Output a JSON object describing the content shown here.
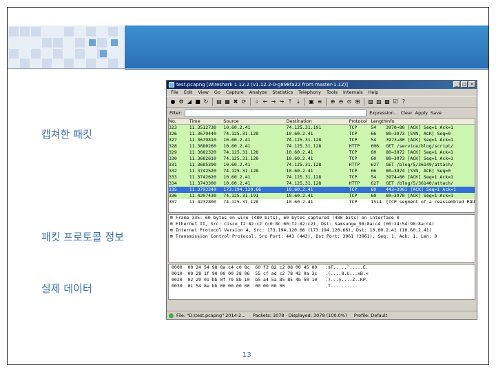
{
  "slide": {
    "label_capture": "캡쳐한 패킷",
    "label_protocol": "패킷 프로토콜 정보",
    "label_data": "실제 데이터",
    "page_number": "13"
  },
  "colors": {
    "banner_blue": "#2a6fb4",
    "label_blue": "#3a6fb0",
    "row_green": "#ccf5b0",
    "row_selected": "#3270d8",
    "row_white": "#ffffff"
  },
  "wireshark": {
    "title": "test.pcapng  [Wireshark 1.12.2  (v1.12.2-0-g898fa22 from master-1.12)]",
    "menus": [
      "File",
      "Edit",
      "View",
      "Go",
      "Capture",
      "Analyze",
      "Statistics",
      "Telephony",
      "Tools",
      "Internals",
      "Help"
    ],
    "toolbar_icons": [
      "record-icon",
      "settings-icon",
      "start-icon",
      "stop-icon",
      "restart-icon",
      "open-icon",
      "save-icon",
      "close-file-icon",
      "reload-icon",
      "find-icon",
      "back-icon",
      "forward-icon",
      "goto-icon",
      "first-icon",
      "last-icon",
      "colorize-icon",
      "autoscroll-icon",
      "zoom-in-icon",
      "zoom-out-icon",
      "zoom-reset-icon",
      "resize-columns-icon",
      "capture-filter-icon",
      "display-filter-icon",
      "coloring-rules-icon",
      "preferences-icon",
      "help-icon"
    ],
    "filter": {
      "label": "Filter:",
      "value": "",
      "expression": "Expression...",
      "clear": "Clear",
      "apply": "Apply",
      "save": "Save"
    },
    "columns": [
      "No.",
      "Time",
      "Source",
      "Destination",
      "Protocol",
      "Length",
      "Info"
    ],
    "packets": [
      {
        "no": "323",
        "time": "11.3512730",
        "src": "10.60.2.41",
        "dst": "74.125.31.191",
        "proto": "TCP",
        "len": "54",
        "info": "3970→80 [ACK] Seq=1 Ack=1",
        "style": "green"
      },
      {
        "no": "326",
        "time": "11.3679440",
        "src": "74.125.31.128",
        "dst": "10.60.2.41",
        "proto": "TCP",
        "len": "66",
        "info": "80→3973 [SYN, ACK] Seq=0",
        "style": "green"
      },
      {
        "no": "327",
        "time": "11.3679810",
        "src": "10.60.2.41",
        "dst": "74.125.31.128",
        "proto": "TCP",
        "len": "54",
        "info": "3973→80 [ACK] Seq=1 Ack=1",
        "style": "green"
      },
      {
        "no": "328",
        "time": "11.3680260",
        "src": "10.60.2.41",
        "dst": "74.125.31.128",
        "proto": "HTTP",
        "len": "606",
        "info": "GET /service/blog/script/",
        "style": "green"
      },
      {
        "no": "329",
        "time": "11.3682320",
        "src": "74.125.31.128",
        "dst": "10.60.2.41",
        "proto": "TCP",
        "len": "60",
        "info": "80→3972 [ACK] Seq=1 Ack=1",
        "style": "green"
      },
      {
        "no": "330",
        "time": "11.3682610",
        "src": "74.125.31.128",
        "dst": "10.60.2.41",
        "proto": "TCP",
        "len": "60",
        "info": "80→3973 [ACK] Seq=1 Ack=1",
        "style": "green"
      },
      {
        "no": "331",
        "time": "11.3685390",
        "src": "10.60.2.41",
        "dst": "74.125.31.128",
        "proto": "HTTP",
        "len": "627",
        "info": "GET /blog/5/36149/attach/",
        "style": "green"
      },
      {
        "no": "332",
        "time": "11.3742520",
        "src": "74.125.31.128",
        "dst": "10.60.2.41",
        "proto": "TCP",
        "len": "66",
        "info": "80→3974 [SYN, ACK] Seq=0",
        "style": "green"
      },
      {
        "no": "333",
        "time": "11.3742620",
        "src": "10.60.2.41",
        "dst": "74.125.31.128",
        "proto": "TCP",
        "len": "54",
        "info": "3974→80 [ACK] Seq=1 Ack=1",
        "style": "green"
      },
      {
        "no": "334",
        "time": "11.3743300",
        "src": "10.60.2.41",
        "dst": "74.125.31.128",
        "proto": "HTTP",
        "len": "627",
        "info": "GET /blog/5/36140/attach/",
        "style": "green"
      },
      {
        "no": "335",
        "time": "11.3792340",
        "src": "173.194.120.66",
        "dst": "10.60.2.41",
        "proto": "TCP",
        "len": "60",
        "info": "443→3961 [ACK] Seq=1 Ack=1",
        "style": "selected"
      },
      {
        "no": "336",
        "time": "11.4207430",
        "src": "74.125.31.191",
        "dst": "10.60.2.41",
        "proto": "TCP",
        "len": "60",
        "info": "80→3970 [ACK] Seq=1 Ack=1",
        "style": "green"
      },
      {
        "no": "337",
        "time": "11.4232800",
        "src": "74.125.31.128",
        "dst": "10.60.2.41",
        "proto": "TCP",
        "len": "1514",
        "info": "[TCP segment of a reassembled PDU]",
        "style": "white"
      }
    ],
    "details": [
      {
        "text": "⊞ Frame 335: 60 bytes on wire (480 bits), 60 bytes captured (480 bits) on interface 0",
        "sel": false
      },
      {
        "text": "⊞ Ethernet II, Src: Cisco_f2:82:c2 (c0:8c:60:f2:82:c2), Dst: Samsunge_98:8a:c4 (00:24:54:98:8a:c4)",
        "sel": false
      },
      {
        "text": "⊞ Internet Protocol Version 4, Src: 173.194.120.66 (173.194.120.66), Dst: 10.60.2.41 (10.60.2.41)",
        "sel": false
      },
      {
        "text": "⊞ Transmission Control Protocol, Src Port: 443 (443), Dst Port: 3961 (3961), Seq: 1, Ack: 1, Len: 0",
        "sel": false
      }
    ],
    "hex": [
      "0000  00 24 54 98 8a c4 c0 8c  60 f2 82 c2 08 00 45 00   .$T.....`.....E.",
      "0010  00 28 1f 90 00 00 38 06  55 cf ad c2 78 42 0a 3c   .(....8.U...xB.<",
      "0020  02 29 01 bb 0f 79 8b 10  b5 a4 5a 85 85 4b 50 10   .)...y....Z..KP.",
      "0030  01 54 8e bb 00 00 00 00  00 00 00 00               .T.........."
    ],
    "status": {
      "file": "File: \"D:\\test.pcapng\" 2014-2…",
      "packets": "Packets: 3078 · Displayed: 3078 (100.0%)",
      "profile": "Profile: Default"
    }
  }
}
